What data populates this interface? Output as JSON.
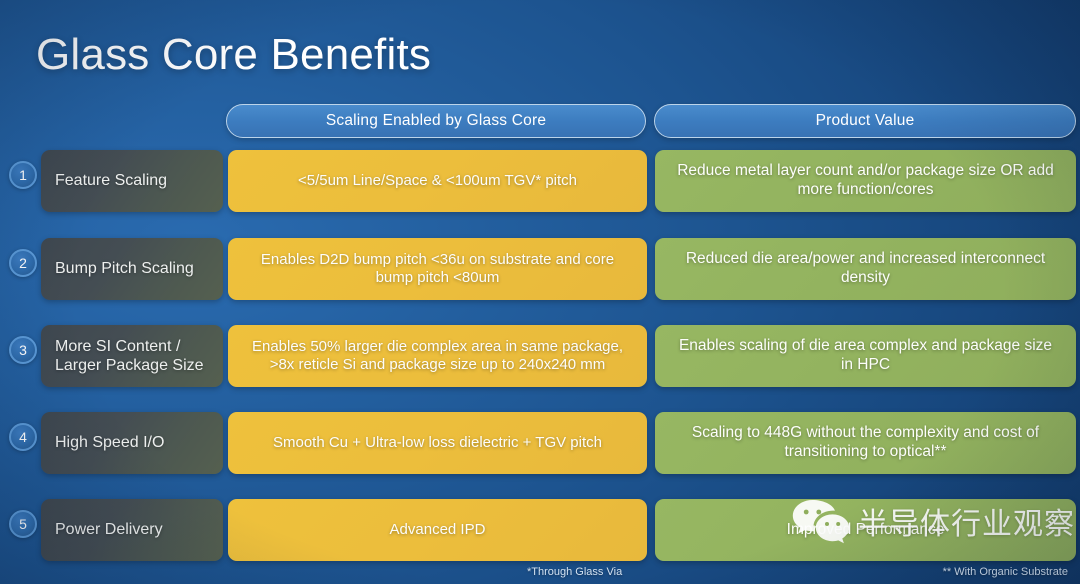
{
  "slide": {
    "title": "Glass Core Benefits",
    "background_color": "#1d5490",
    "accent_header_color": "#3d7dc0",
    "gold_color": "#ecbe3c",
    "green_color": "#93b35f",
    "label_color": "#454e54"
  },
  "headers": {
    "scaling": "Scaling Enabled by Glass Core",
    "product": "Product Value"
  },
  "rows": [
    {
      "number": "1",
      "label": "Feature Scaling",
      "scaling": "<5/5um Line/Space & <100um TGV* pitch",
      "product": "Reduce metal layer count and/or package size OR add more function/cores"
    },
    {
      "number": "2",
      "label": "Bump Pitch Scaling",
      "scaling": "Enables D2D bump pitch <36u on substrate and core bump pitch <80um",
      "product": "Reduced die area/power and increased interconnect density"
    },
    {
      "number": "3",
      "label": "More SI Content / Larger Package Size",
      "scaling": "Enables 50% larger die complex area in same package, >8x reticle Si and package size up to 240x240 mm",
      "product": "Enables scaling of die area complex and package size in HPC"
    },
    {
      "number": "4",
      "label": "High Speed I/O",
      "scaling": "Smooth Cu + Ultra-low loss dielectric + TGV pitch",
      "product": "Scaling to 448G without the complexity and cost of transitioning to optical**"
    },
    {
      "number": "5",
      "label": "Power Delivery",
      "scaling": "Advanced IPD",
      "product": "Improved Performance"
    }
  ],
  "footnotes": {
    "left": "*Through Glass Via",
    "right": "** With Organic Substrate"
  },
  "watermark": {
    "text": "半导体行业观察",
    "logo": "wechat-icon"
  }
}
